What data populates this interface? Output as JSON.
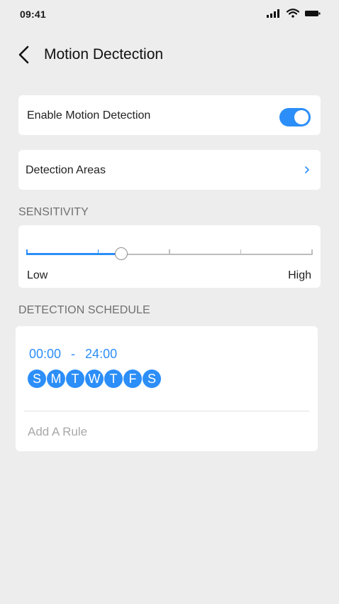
{
  "status_bar": {
    "time": "09:41",
    "icons": [
      "signal-icon",
      "wifi-icon",
      "battery-icon"
    ]
  },
  "nav": {
    "back_icon": "chevron-left-icon",
    "title": "Motion Dectection"
  },
  "motion_detection": {
    "label": "Enable Motion Detection",
    "enabled": true
  },
  "detection_areas": {
    "label": "Detection Areas",
    "icon": "chevron-right-icon"
  },
  "sensitivity": {
    "header": "SENSITIVITY",
    "min_label": "Low",
    "max_label": "High",
    "steps": 4,
    "value_fraction": 0.33
  },
  "schedule": {
    "header": "DETECTION SCHEDULE",
    "start_time": "00:00",
    "separator": "-",
    "end_time": "24:00",
    "days": [
      "S",
      "M",
      "T",
      "W",
      "T",
      "F",
      "S"
    ],
    "add_rule_label": "Add A Rule"
  },
  "colors": {
    "accent": "#2c8ef8",
    "background": "#ededed",
    "card": "#ffffff",
    "section_header": "#707070",
    "placeholder": "#a8a8a8"
  }
}
